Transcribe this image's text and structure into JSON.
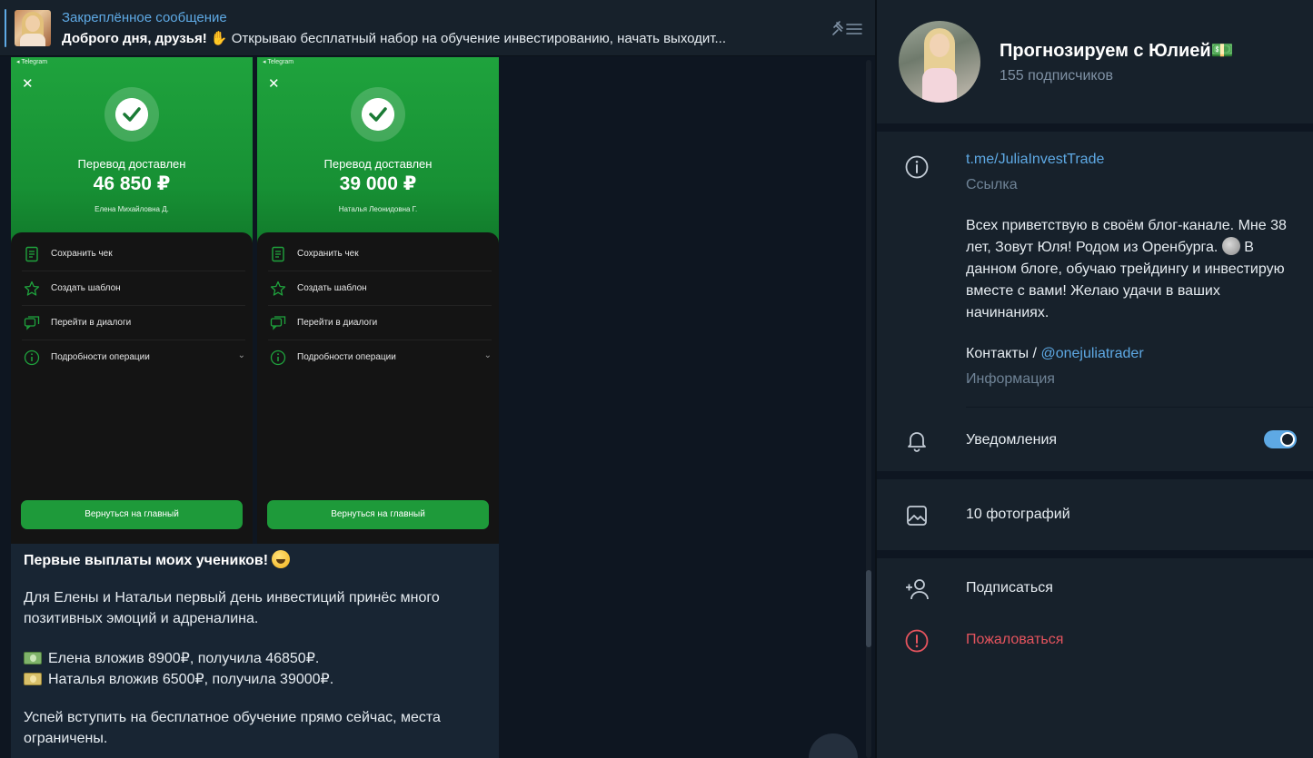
{
  "pinned": {
    "title": "Закреплённое сообщение",
    "text_bold": "Доброго дня, друзья!",
    "text_rest": "Открываю бесплатный набор на обучение инвестированию, начать выходит..."
  },
  "receipts": [
    {
      "app_label": "◂ Telegram",
      "status": "Перевод доставлен",
      "amount": "46 850 ₽",
      "recipient": "Елена Михайловна Д.",
      "menu": [
        "Сохранить чек",
        "Создать шаблон",
        "Перейти в диалоги",
        "Подробности операции"
      ],
      "button": "Вернуться на главный"
    },
    {
      "app_label": "◂ Telegram",
      "status": "Перевод доставлен",
      "amount": "39 000 ₽",
      "recipient": "Наталья Леонидовна Г.",
      "menu": [
        "Сохранить чек",
        "Создать шаблон",
        "Перейти в диалоги",
        "Подробности операции"
      ],
      "button": "Вернуться на главный"
    }
  ],
  "message": {
    "title": "Первые выплаты моих учеников!",
    "p1_l1": "Для Елены и Натальи первый день инвестиций принёс много",
    "p1_l2": "позитивных эмоций и адреналина.",
    "item1": "Елена вложив 8900₽, получила 46850₽.",
    "item2": "Наталья вложив 6500₽, получила 39000₽.",
    "p3_l1": "Успей вступить на бесплатное обучение прямо сейчас, места",
    "p3_l2": "ограничены."
  },
  "channel": {
    "name": "Прогнозируем с Юлией💵",
    "subscribers": "155 подписчиков",
    "link": "t.me/JuliaInvestTrade",
    "link_caption": "Ссылка",
    "about_text": "Всех приветствую в своём блог-канале. Мне 38 лет, Зовут Юля! Родом из Оренбурга.",
    "about_text2": "В данном блоге, обучаю трейдингу и инвестирую вместе с вами! Желаю удачи в ваших начинаниях.",
    "contacts_prefix": "Контакты /",
    "contacts_handle": "@onejuliatrader",
    "about_caption": "Информация",
    "notifications_label": "Уведомления",
    "notifications_on": true,
    "photos_label": "10 фотографий",
    "subscribe_label": "Подписаться",
    "report_label": "Пожаловаться"
  },
  "colors": {
    "accent": "#5ea9e4",
    "panel": "#17212b",
    "background": "#0e1621",
    "danger": "#e5545e",
    "receipt_green": "#1fa33d"
  }
}
